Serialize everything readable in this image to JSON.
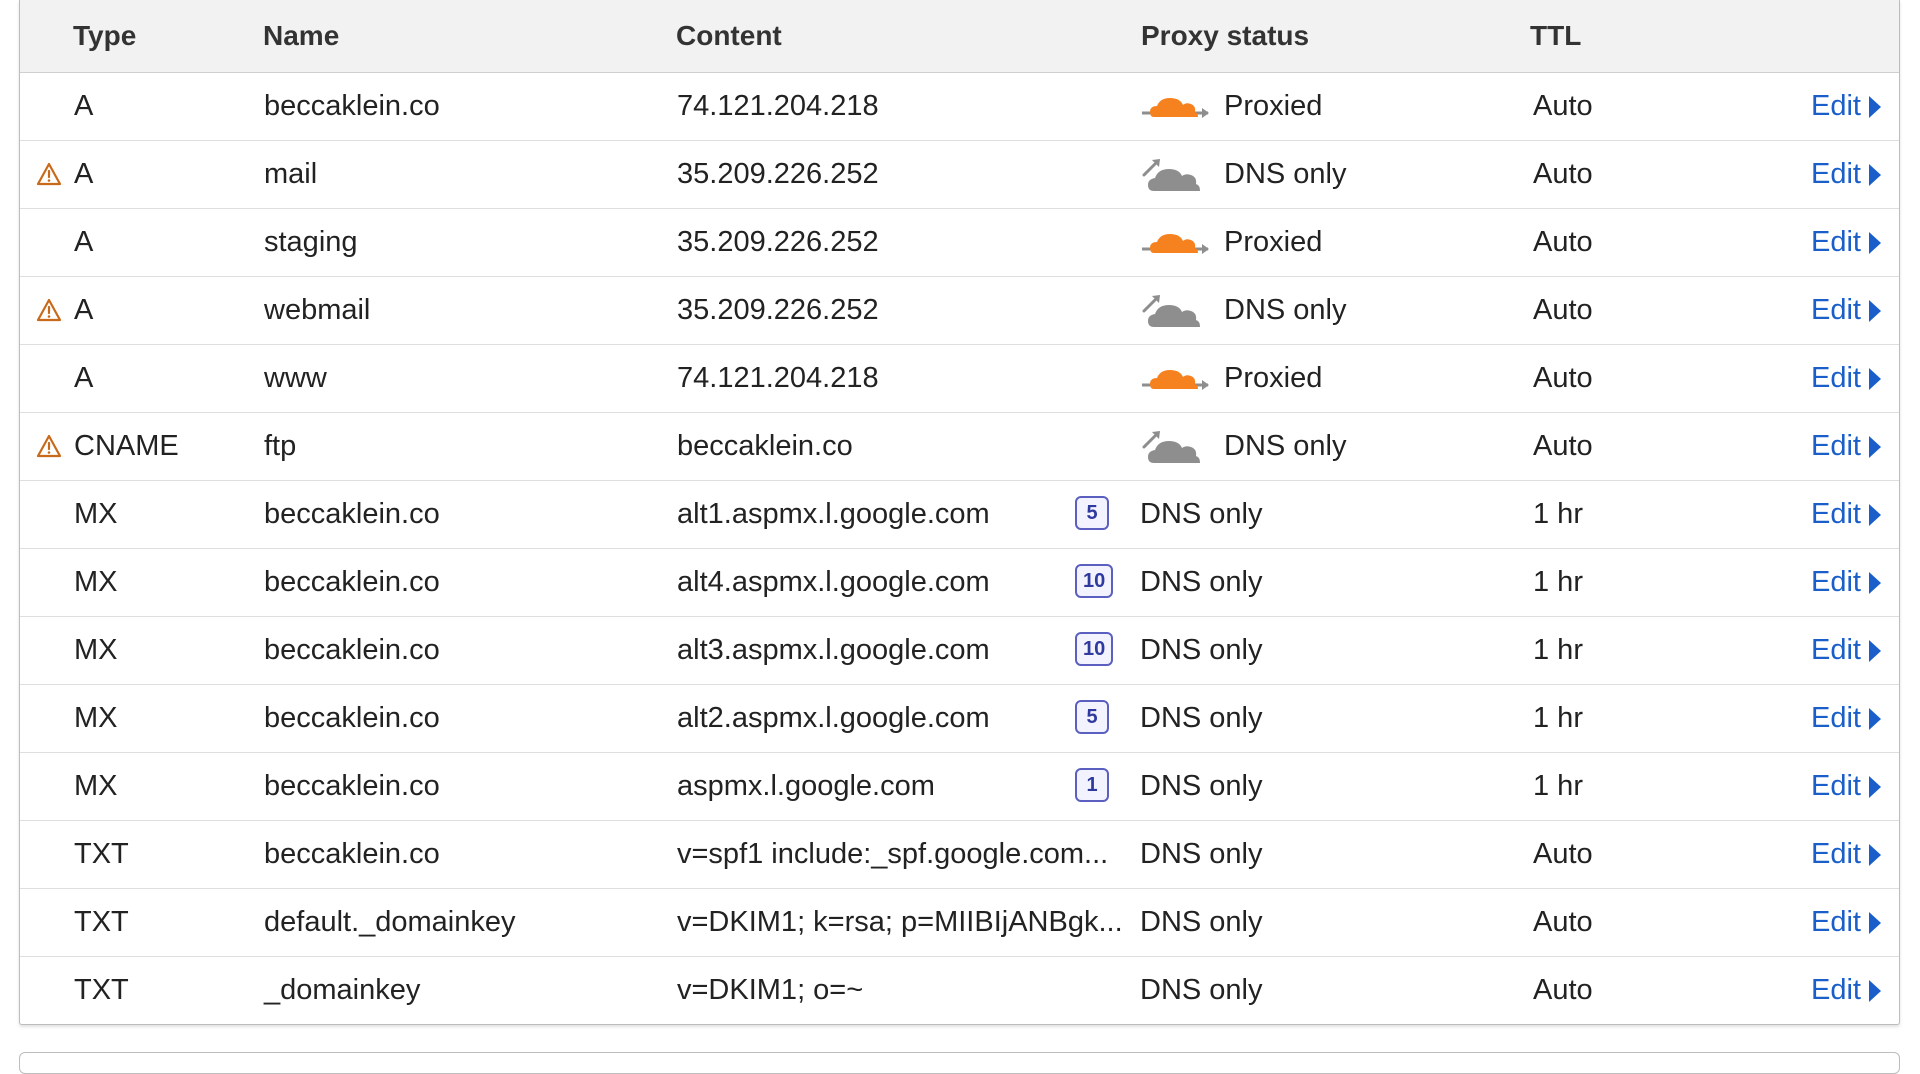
{
  "columns": {
    "type": "Type",
    "name": "Name",
    "content": "Content",
    "proxy_status": "Proxy status",
    "ttl": "TTL"
  },
  "colors": {
    "proxied_cloud": "#f6821f",
    "dns_only_cloud": "#8e8e8e",
    "warning": "#c86a1a",
    "link": "#1a5fc9",
    "priority_border": "#5a5fc0"
  },
  "rows": [
    {
      "warning": false,
      "type": "A",
      "name": "beccaklein.co",
      "content": "74.121.204.218",
      "priority": "",
      "proxy": "Proxied",
      "proxy_icon": "proxied-cloud-icon",
      "ttl": "Auto",
      "edit": "Edit"
    },
    {
      "warning": true,
      "type": "A",
      "name": "mail",
      "content": "35.209.226.252",
      "priority": "",
      "proxy": "DNS only",
      "proxy_icon": "dns-only-cloud-icon",
      "ttl": "Auto",
      "edit": "Edit"
    },
    {
      "warning": false,
      "type": "A",
      "name": "staging",
      "content": "35.209.226.252",
      "priority": "",
      "proxy": "Proxied",
      "proxy_icon": "proxied-cloud-icon",
      "ttl": "Auto",
      "edit": "Edit"
    },
    {
      "warning": true,
      "type": "A",
      "name": "webmail",
      "content": "35.209.226.252",
      "priority": "",
      "proxy": "DNS only",
      "proxy_icon": "dns-only-cloud-icon",
      "ttl": "Auto",
      "edit": "Edit"
    },
    {
      "warning": false,
      "type": "A",
      "name": "www",
      "content": "74.121.204.218",
      "priority": "",
      "proxy": "Proxied",
      "proxy_icon": "proxied-cloud-icon",
      "ttl": "Auto",
      "edit": "Edit"
    },
    {
      "warning": true,
      "type": "CNAME",
      "name": "ftp",
      "content": "beccaklein.co",
      "priority": "",
      "proxy": "DNS only",
      "proxy_icon": "dns-only-cloud-icon",
      "ttl": "Auto",
      "edit": "Edit"
    },
    {
      "warning": false,
      "type": "MX",
      "name": "beccaklein.co",
      "content": "alt1.aspmx.l.google.com",
      "priority": "5",
      "proxy": "DNS only",
      "proxy_icon": "",
      "ttl": "1 hr",
      "edit": "Edit"
    },
    {
      "warning": false,
      "type": "MX",
      "name": "beccaklein.co",
      "content": "alt4.aspmx.l.google.com",
      "priority": "10",
      "proxy": "DNS only",
      "proxy_icon": "",
      "ttl": "1 hr",
      "edit": "Edit"
    },
    {
      "warning": false,
      "type": "MX",
      "name": "beccaklein.co",
      "content": "alt3.aspmx.l.google.com",
      "priority": "10",
      "proxy": "DNS only",
      "proxy_icon": "",
      "ttl": "1 hr",
      "edit": "Edit"
    },
    {
      "warning": false,
      "type": "MX",
      "name": "beccaklein.co",
      "content": "alt2.aspmx.l.google.com",
      "priority": "5",
      "proxy": "DNS only",
      "proxy_icon": "",
      "ttl": "1 hr",
      "edit": "Edit"
    },
    {
      "warning": false,
      "type": "MX",
      "name": "beccaklein.co",
      "content": "aspmx.l.google.com",
      "priority": "1",
      "proxy": "DNS only",
      "proxy_icon": "",
      "ttl": "1 hr",
      "edit": "Edit"
    },
    {
      "warning": false,
      "type": "TXT",
      "name": "beccaklein.co",
      "content": "v=spf1 include:_spf.google.com...",
      "priority": "",
      "proxy": "DNS only",
      "proxy_icon": "",
      "ttl": "Auto",
      "edit": "Edit"
    },
    {
      "warning": false,
      "type": "TXT",
      "name": "default._domainkey",
      "content": "v=DKIM1; k=rsa; p=MIIBIjANBgk...",
      "priority": "",
      "proxy": "DNS only",
      "proxy_icon": "",
      "ttl": "Auto",
      "edit": "Edit"
    },
    {
      "warning": false,
      "type": "TXT",
      "name": "_domainkey",
      "content": "v=DKIM1; o=~",
      "priority": "",
      "proxy": "DNS only",
      "proxy_icon": "",
      "ttl": "Auto",
      "edit": "Edit"
    }
  ]
}
